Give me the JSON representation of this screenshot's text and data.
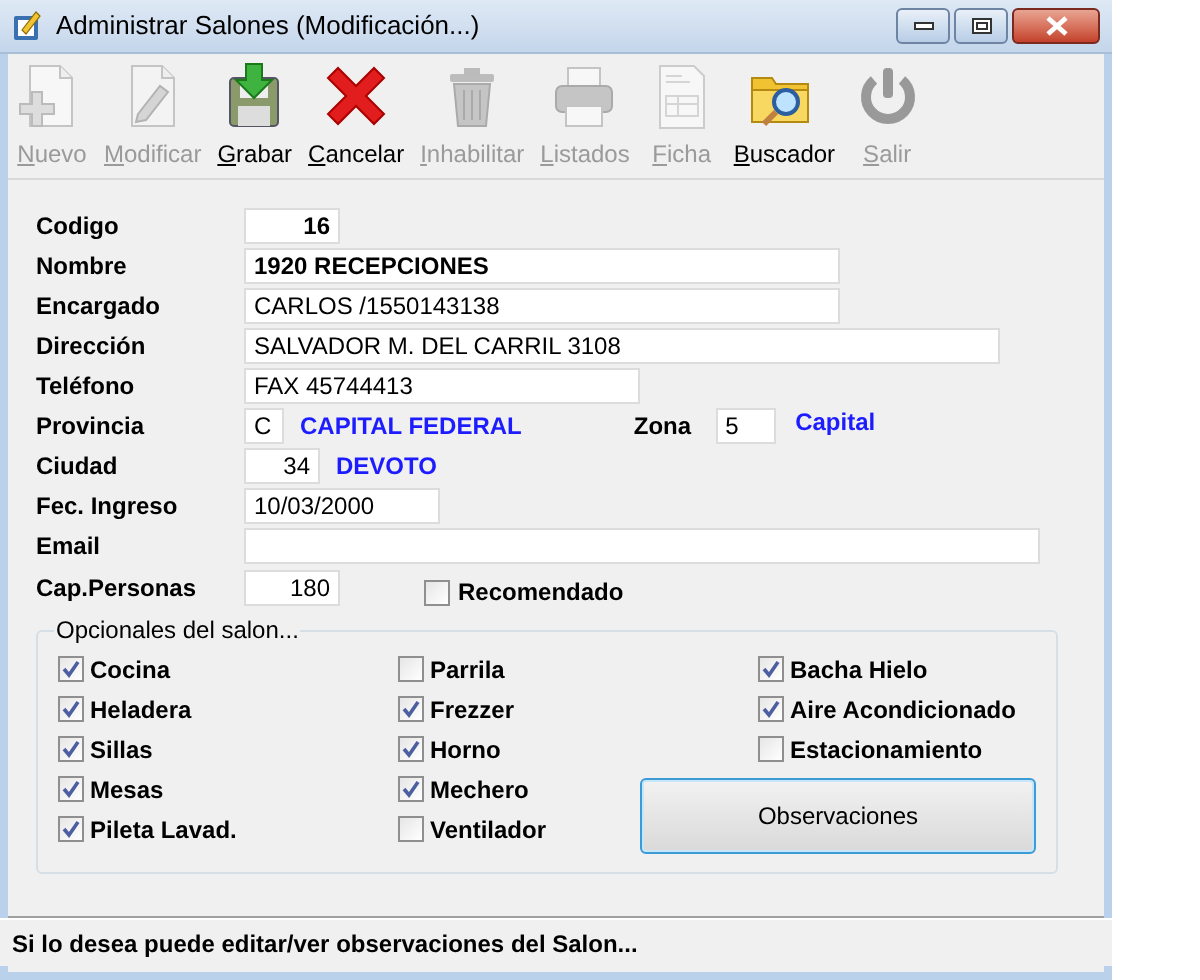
{
  "window": {
    "title": "Administrar Salones (Modificación...)"
  },
  "toolbar": [
    {
      "label": "Nuevo",
      "disabled": true
    },
    {
      "label": "Modificar",
      "disabled": true
    },
    {
      "label": "Grabar",
      "disabled": false
    },
    {
      "label": "Cancelar",
      "disabled": false
    },
    {
      "label": "Inhabilitar",
      "disabled": true
    },
    {
      "label": "Listados",
      "disabled": true
    },
    {
      "label": "Ficha",
      "disabled": true
    },
    {
      "label": "Buscador",
      "disabled": false
    },
    {
      "label": "Salir",
      "disabled": true
    }
  ],
  "fields": [
    {
      "label": "Codigo",
      "value": "16"
    },
    {
      "label": "Nombre",
      "value": "1920 RECEPCIONES"
    },
    {
      "label": "Encargado",
      "value": "CARLOS /1550143138"
    },
    {
      "label": "Dirección",
      "value": "SALVADOR M. DEL CARRIL 3108"
    },
    {
      "label": "Teléfono",
      "value": "FAX 45744413"
    },
    {
      "label": "Provincia",
      "value": "C",
      "lookup": "CAPITAL FEDERAL"
    },
    {
      "label": "Ciudad",
      "value": "34",
      "lookup": "DEVOTO"
    },
    {
      "label": "Fec. Ingreso",
      "value": "10/03/2000"
    },
    {
      "label": "Email"
    },
    {
      "label": "Cap.Personas",
      "value": "180"
    }
  ],
  "zona": {
    "label": "Zona",
    "value": "5",
    "lookup": "Capital"
  },
  "recomendado": {
    "label": "Recomendado",
    "checked": false
  },
  "opcionales": {
    "title": "Opcionales del salon...",
    "columns": [
      [
        {
          "label": "Cocina",
          "checked": true
        },
        {
          "label": "Heladera",
          "checked": true
        },
        {
          "label": "Sillas",
          "checked": true
        },
        {
          "label": "Mesas",
          "checked": true
        },
        {
          "label": "Pileta Lavad.",
          "checked": true
        }
      ],
      [
        {
          "label": "Parrila",
          "checked": false
        },
        {
          "label": "Frezzer",
          "checked": true
        },
        {
          "label": "Horno",
          "checked": true
        },
        {
          "label": "Mechero",
          "checked": true
        },
        {
          "label": "Ventilador",
          "checked": false
        }
      ],
      [
        {
          "label": "Bacha Hielo",
          "checked": true
        },
        {
          "label": "Aire Acondicionado",
          "checked": true
        },
        {
          "label": "Estacionamiento",
          "checked": false
        }
      ]
    ],
    "button": "Observaciones"
  },
  "status_bar": "Si lo desea puede editar/ver observaciones del Salon..."
}
